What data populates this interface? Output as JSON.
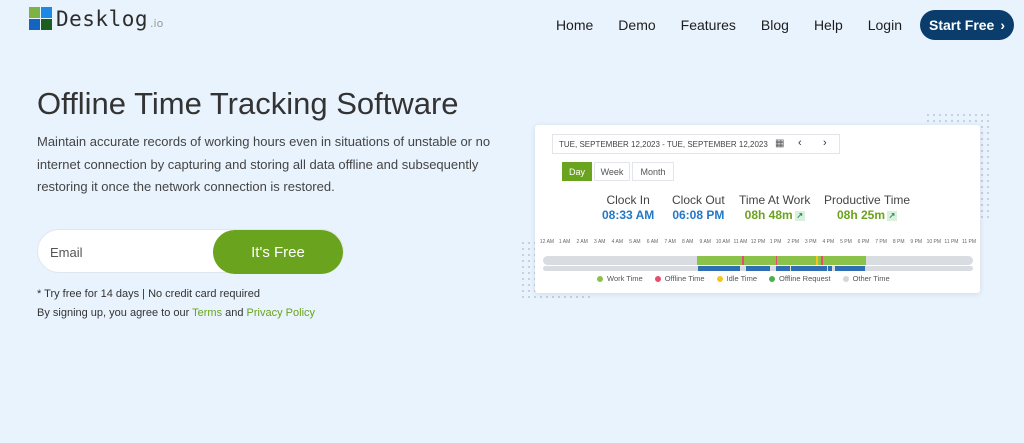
{
  "header": {
    "logo_text": "Desklog",
    "logo_suffix": ".io",
    "nav": [
      "Home",
      "Demo",
      "Features",
      "Blog",
      "Help",
      "Login"
    ],
    "cta_label": "Start Free",
    "cta_icon": "chevron-right-icon"
  },
  "hero": {
    "title": "Offline Time Tracking Software",
    "description": "Maintain accurate records of working hours even in situations of unstable or no internet connection by capturing and storing all data offline and subsequently restoring it once the network connection is restored.",
    "email_placeholder": "Email",
    "submit_label": "It's  Free",
    "note_line1": "* Try free for 14 days | No credit card required",
    "note_line2_prefix": "By signing up, you agree to our ",
    "terms_label": "Terms",
    "note_and": " and ",
    "privacy_label": "Privacy Policy",
    "link_color": "#6aa31d"
  },
  "widget": {
    "date_range": "TUE, SEPTEMBER 12,2023 - TUE, SEPTEMBER 12,2023",
    "tabs": [
      "Day",
      "Week",
      "Month"
    ],
    "active_tab": "Day",
    "stats": {
      "clock_in_label": "Clock In",
      "clock_in_value": "08:33 AM",
      "clock_out_label": "Clock Out",
      "clock_out_value": "06:08 PM",
      "time_at_work_label": "Time At Work",
      "time_at_work_value": "08h 48m",
      "productive_label": "Productive Time",
      "productive_value": "08h 25m"
    },
    "hours": [
      "12 AM",
      "1 AM",
      "2 AM",
      "3 AM",
      "4 AM",
      "5 AM",
      "6 AM",
      "7 AM",
      "8 AM",
      "9 AM",
      "10 AM",
      "11 AM",
      "12 PM",
      "1 PM",
      "2 PM",
      "3 PM",
      "4 PM",
      "5 PM",
      "6 PM",
      "7 PM",
      "8 PM",
      "9 PM",
      "10 PM",
      "11 PM",
      "11 PM"
    ],
    "legend": [
      {
        "label": "Work Time",
        "color": "#8bc34a"
      },
      {
        "label": "Offline Time",
        "color": "#e84e6a"
      },
      {
        "label": "Idle Time",
        "color": "#f5c518"
      },
      {
        "label": "Offline Request",
        "color": "#4caf50"
      },
      {
        "label": "Other Time",
        "color": "#d3d6da"
      }
    ],
    "activity_start_hour": 8.55,
    "activity_end_hour": 18.13,
    "offline_marks_hours": [
      11.1,
      13.0,
      15.6
    ],
    "idle_marks_hours": [
      15.3
    ],
    "blue_segments_hours": [
      [
        8.6,
        11.0
      ],
      [
        11.3,
        12.7
      ],
      [
        13.0,
        13.8
      ],
      [
        13.9,
        15.9
      ],
      [
        16.0,
        16.2
      ],
      [
        16.4,
        18.1
      ]
    ],
    "accent_blue": "#2178c9",
    "accent_green": "#6aa31d",
    "cta_bg": "#0a3d6b"
  }
}
